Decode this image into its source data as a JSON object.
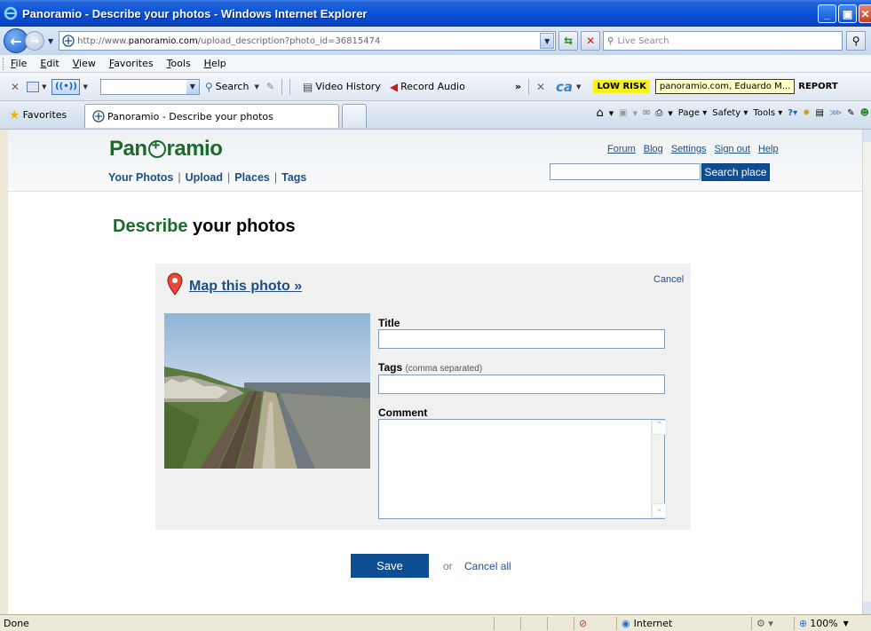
{
  "window": {
    "title": "Panoramio - Describe your photos - Windows Internet Explorer"
  },
  "address_bar": {
    "url_prefix": "http://www.",
    "url_domain": "panoramio.com",
    "url_path": "/upload_description?photo_id=36815474",
    "search_placeholder": "Live Search"
  },
  "menu": [
    "File",
    "Edit",
    "View",
    "Favorites",
    "Tools",
    "Help"
  ],
  "toolbar": {
    "search_label": "Search",
    "video_history": "Video History",
    "record_audio": "Record Audio",
    "ca_label": "ca",
    "low_risk": "LOW RISK",
    "site_info": "panoramio.com, Eduardo M...",
    "report": "REPORT"
  },
  "tabs": {
    "favorites": "Favorites",
    "active_tab": "Panoramio - Describe your photos"
  },
  "commands": {
    "page": "Page",
    "safety": "Safety",
    "tools": "Tools"
  },
  "site": {
    "logo_pre": "Pan",
    "logo_post": "ramio",
    "nav": [
      "Your Photos",
      "Upload",
      "Places",
      "Tags"
    ],
    "top_links": [
      "Forum",
      "Blog",
      "Settings",
      "Sign out",
      "Help"
    ],
    "search_button": "Search place"
  },
  "page": {
    "title_accent": "Describe",
    "title_rest": " your photos",
    "map_link": "Map this photo »",
    "cancel": "Cancel",
    "title_label": "Title",
    "tags_label": "Tags",
    "tags_hint": "(comma separated)",
    "comment_label": "Comment",
    "save": "Save",
    "or": "or",
    "cancel_all": "Cancel all"
  },
  "status": {
    "left": "Done",
    "zone": "Internet",
    "zoom": "100%"
  },
  "colors": {
    "brand_green": "#1b6a2a",
    "link_blue": "#1d4f86",
    "button_blue": "#0f4e93"
  }
}
